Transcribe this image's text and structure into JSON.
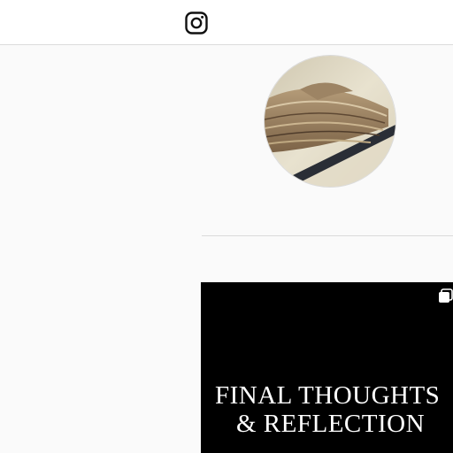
{
  "header": {
    "logo_icon": "instagram-icon"
  },
  "profile": {
    "avatar_icon": "old-book-photo"
  },
  "posts": [
    {
      "title_line1": "FINAL THOUGHTS",
      "title_line2": "& REFLECTION",
      "type_icon": "multiple-posts-icon",
      "background": "#000000",
      "text_color": "#ffffff"
    }
  ],
  "colors": {
    "page_background": "#fafafa",
    "header_background": "#ffffff",
    "border": "#dbdbdb"
  }
}
